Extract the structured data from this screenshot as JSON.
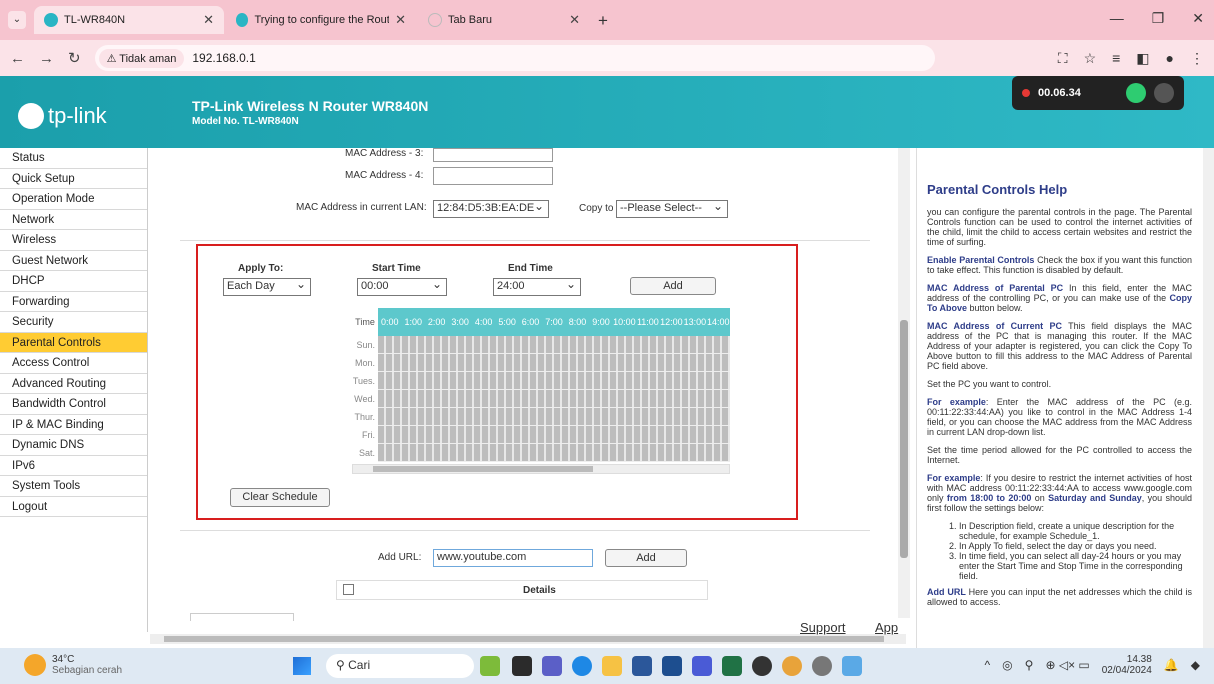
{
  "browser": {
    "tabs": [
      {
        "title": "TL-WR840N",
        "active": true
      },
      {
        "title": "Trying to configure the Router?",
        "active": false
      },
      {
        "title": "Tab Baru",
        "active": false
      }
    ],
    "security_label": "Tidak aman",
    "url": "192.168.0.1"
  },
  "recorder": {
    "time": "00.06.34"
  },
  "router": {
    "brand": "tp-link",
    "title": "TP-Link Wireless N Router WR840N",
    "model": "Model No. TL-WR840N"
  },
  "menu": [
    "Status",
    "Quick Setup",
    "Operation Mode",
    "Network",
    "Wireless",
    "Guest Network",
    "DHCP",
    "Forwarding",
    "Security",
    "Parental Controls",
    "Access Control",
    "Advanced Routing",
    "Bandwidth Control",
    "IP & MAC Binding",
    "Dynamic DNS",
    "IPv6",
    "System Tools",
    "Logout"
  ],
  "active_menu": "Parental Controls",
  "form": {
    "mac3_label": "MAC Address - 3:",
    "mac4_label": "MAC Address - 4:",
    "lan_label": "MAC Address in current LAN:",
    "lan_value": "12:84:D5:3B:EA:DE",
    "copy_label": "Copy to",
    "copy_value": "--Please Select--",
    "schedule": {
      "apply_label": "Apply To:",
      "apply_value": "Each Day",
      "start_label": "Start Time",
      "start_value": "00:00",
      "end_label": "End Time",
      "end_value": "24:00",
      "add_label": "Add",
      "time_label": "Time",
      "hours": [
        "0:00",
        "1:00",
        "2:00",
        "3:00",
        "4:00",
        "5:00",
        "6:00",
        "7:00",
        "8:00",
        "9:00",
        "10:00",
        "11:00",
        "12:00",
        "13:00",
        "14:00"
      ],
      "days": [
        "Sun.",
        "Mon.",
        "Tues.",
        "Wed.",
        "Thur.",
        "Fri.",
        "Sat."
      ],
      "clear_label": "Clear Schedule"
    },
    "url_label": "Add URL:",
    "url_value": "www.youtube.com",
    "url_add_label": "Add",
    "details_label": "Details"
  },
  "footer": {
    "support": "Support",
    "app": "App"
  },
  "help": {
    "title": "Parental Controls Help",
    "intro": "you can configure the parental controls in the page. The Parental Controls function can be used to control the internet activities of the child, limit the child to access certain websites and restrict the time of surfing.",
    "enable_title": "Enable Parental Controls",
    "enable_text": " Check the box if you want this function to take effect. This function is disabled by default.",
    "mac_parent_title": "MAC Address of Parental PC",
    "mac_parent_text": " In this field, enter the MAC address of the controlling PC, or you can make use of the ",
    "copy_above": "Copy To Above",
    "mac_parent_end": " button below.",
    "mac_current_title": "MAC Address of Current PC",
    "mac_current_text": " This field displays the MAC address of the PC that is managing this router. If the MAC Address of your adapter is registered, you can click the Copy To Above button to fill this address to the MAC Address of Parental PC field above.",
    "set_pc": "Set the PC you want to control.",
    "example1_title": "For example",
    "example1_text": ": Enter the MAC address of the PC (e.g. 00:11:22:33:44:AA) you like to control in the MAC Address 1-4 field, or you can choose the MAC address from the MAC Address in current LAN drop-down list.",
    "set_time": "Set the time period allowed for the PC controlled to access the Internet.",
    "example2_title": "For example",
    "example2_a": ": If you desire to restrict the internet activities of host with MAC address 00:11:22:33:44:AA to access www.google.com only ",
    "example2_b": "from 18:00 to 20:00",
    "example2_c": " on ",
    "example2_d": "Saturday and Sunday",
    "example2_e": ", you should first follow the settings below:",
    "steps": [
      "In Description field, create a unique description for the schedule, for example Schedule_1.",
      "In Apply To field, select the day or days you need.",
      "In time field, you can select all day-24 hours or you may enter the Start Time and Stop Time in the corresponding field."
    ],
    "add_url_title": "Add URL",
    "add_url_text": " Here you can input the net addresses which the child is allowed to access."
  },
  "taskbar": {
    "temp": "34°C",
    "weather": "Sebagian cerah",
    "search": "Cari",
    "time": "14.38",
    "date": "02/04/2024"
  }
}
